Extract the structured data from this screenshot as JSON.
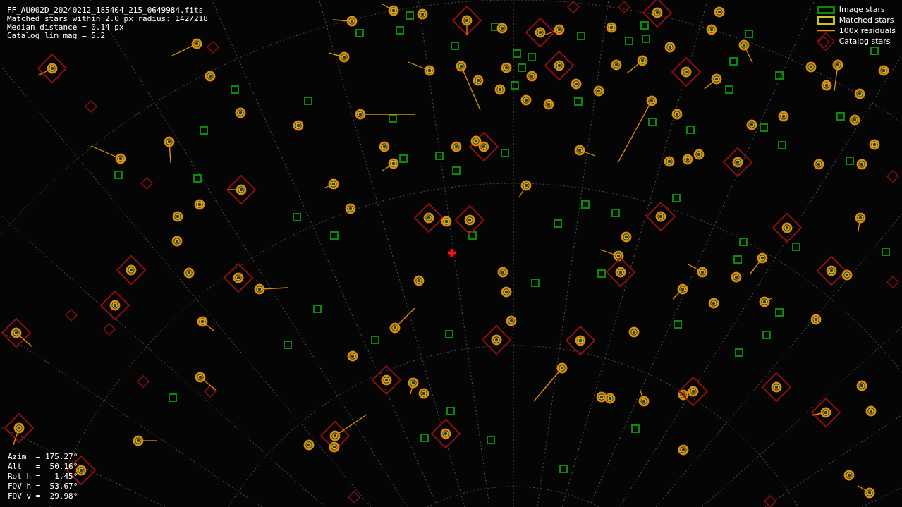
{
  "header": [
    "FF_AU002D_20240212_185404_215_0649984.fits",
    "Matched stars within 2.0 px radius: 142/218",
    "Median distance = 0.14 px",
    "Catalog lim mag = 5.2"
  ],
  "legend": [
    {
      "kind": "image",
      "label": "Image stars"
    },
    {
      "kind": "matched",
      "label": "Matched stars"
    },
    {
      "kind": "residual",
      "label": "100x residuals"
    },
    {
      "kind": "catalog",
      "label": "Catalog stars"
    }
  ],
  "pointing": [
    "Azim  = 175.27°",
    "Alt   =  50.16°",
    "Rot h =   1.45°",
    "FOV h =  53.67°",
    "FOV v =  29.98°"
  ]
}
